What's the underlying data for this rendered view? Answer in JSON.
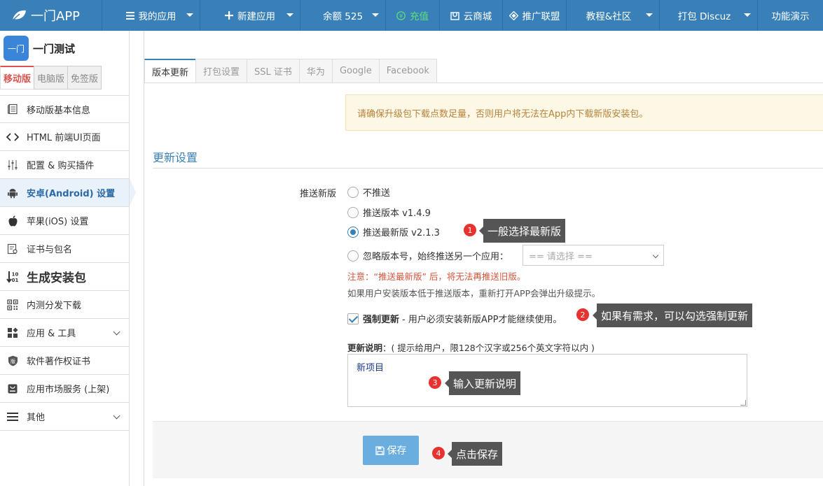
{
  "topbar": {
    "logo": "一门APP",
    "nav": [
      {
        "label": "我的应用",
        "icon": "menu-icon",
        "caret": true
      },
      {
        "label": "新建应用",
        "icon": "plus-icon",
        "caret": true
      },
      {
        "label": "余额 525",
        "icon": "",
        "caret": true
      },
      {
        "label": "充值",
        "icon": "yen-icon",
        "caret": false
      },
      {
        "label": "云商城",
        "icon": "store-icon",
        "caret": false
      },
      {
        "label": "推广联盟",
        "icon": "diamond-icon",
        "caret": false
      },
      {
        "label": "教程&社区",
        "icon": "",
        "caret": true
      },
      {
        "label": "打包 Discuz",
        "icon": "",
        "caret": true
      },
      {
        "label": "功能演示",
        "icon": "",
        "caret": false
      }
    ]
  },
  "sidebar": {
    "app_icon_text": "一门",
    "app_name": "一门测试",
    "version_tabs": [
      "移动版",
      "电脑版",
      "免签版"
    ],
    "items": [
      {
        "label": "移动版基本信息",
        "icon": "document-icon"
      },
      {
        "label": "HTML 前端UI页面",
        "icon": "code-icon"
      },
      {
        "label": "配置 & 购买插件",
        "icon": "sliders-icon"
      },
      {
        "label": "安卓(Android) 设置",
        "icon": "android-icon"
      },
      {
        "label": "苹果(iOS) 设置",
        "icon": "apple-icon"
      },
      {
        "label": "证书与包名",
        "icon": "certificate-icon"
      },
      {
        "label": "生成安装包",
        "icon": "sort-numeric-icon"
      },
      {
        "label": "内测分发下载",
        "icon": "qrcode-icon"
      },
      {
        "label": "应用 & 工具",
        "icon": "apps-icon"
      },
      {
        "label": "软件著作权证书",
        "icon": "shield-icon"
      },
      {
        "label": "应用市场服务 (上架)",
        "icon": "market-icon"
      },
      {
        "label": "其他",
        "icon": "list-icon"
      }
    ]
  },
  "tabs": [
    "版本更新",
    "打包设置",
    "SSL 证书",
    "华为",
    "Google",
    "Facebook"
  ],
  "notice": "请确保升级包下载点数足量，否则用户将无法在App内下载新版安装包。",
  "section_title": "更新设置",
  "form": {
    "push_label": "推送新版",
    "options": [
      "不推送",
      "推送版本 v1.4.9",
      "推送最新版 v2.1.3",
      "忽略版本号，始终推送另一个应用："
    ],
    "selected_option": 2,
    "select_placeholder": "== 请选择 ==",
    "warning": "注意：“推送最新版” 后，将无法再推送旧版。",
    "hint": "如果用户安装版本低于推送版本，重新打开APP会弹出升级提示。",
    "force_update_bold": "强制更新",
    "force_update_text": "- 用户必须安装新版APP才能继续使用。",
    "force_update_checked": true,
    "desc_label_bold": "更新说明",
    "desc_label_text": "：( 提示给用户，限128个汉字或256个英文字符以内 )",
    "desc_value": "新项目",
    "save_label": "保存"
  },
  "annotations": [
    {
      "num": "1",
      "text": "一般选择最新版"
    },
    {
      "num": "2",
      "text": "如果有需求，可以勾选强制更新"
    },
    {
      "num": "3",
      "text": "输入更新说明"
    },
    {
      "num": "4",
      "text": "点击保存"
    }
  ],
  "colors": {
    "topbar": "#3a80b8",
    "accent_red": "#d9534f",
    "save_button": "#6aaee0",
    "tooltip": "#555555",
    "badge": "#e8322f"
  }
}
